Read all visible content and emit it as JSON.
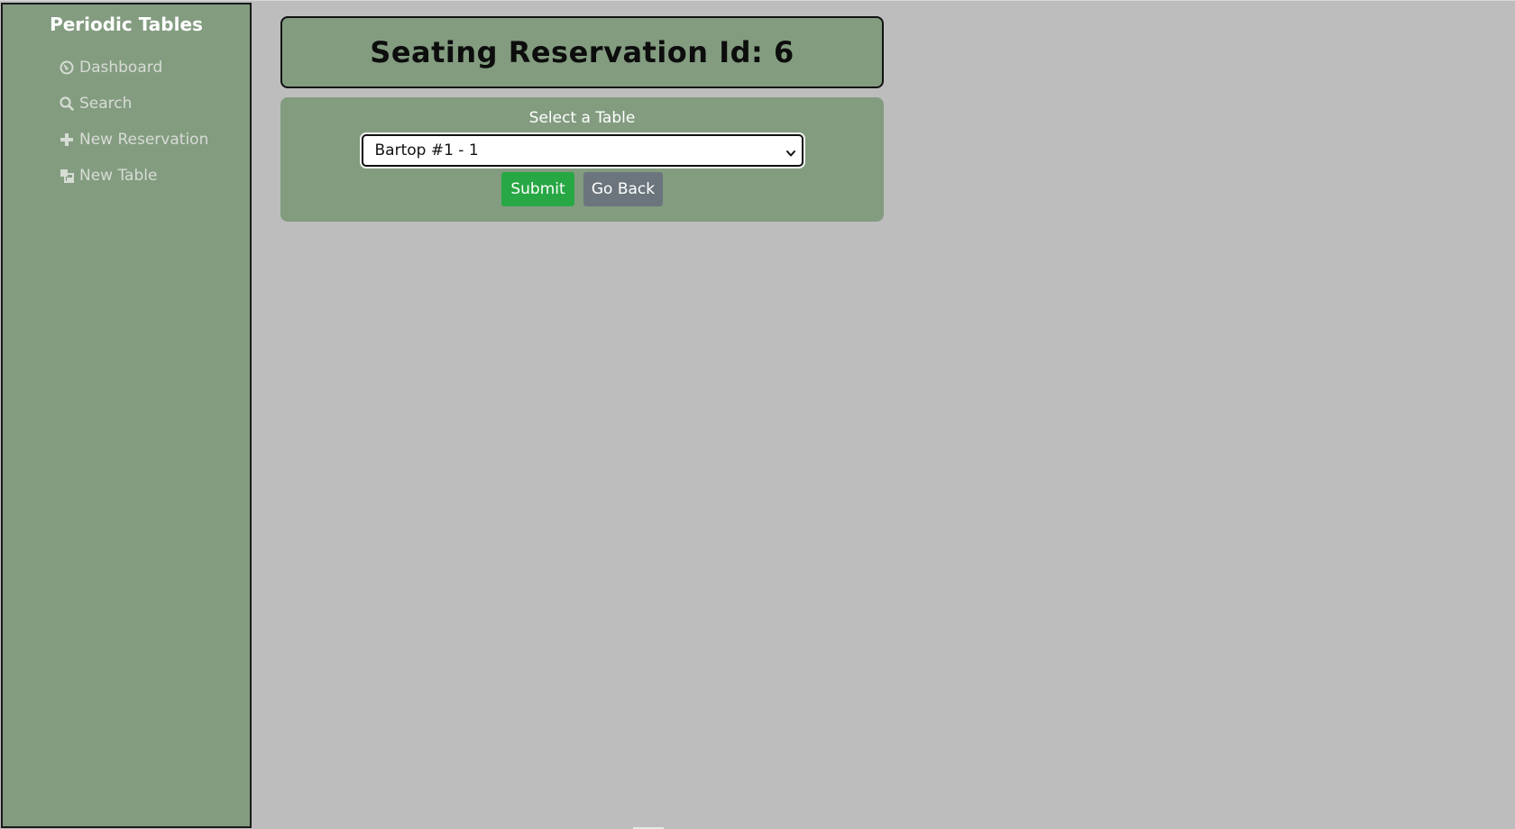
{
  "sidebar": {
    "brand": "Periodic Tables",
    "items": [
      {
        "label": "Dashboard",
        "icon": "dashboard-icon"
      },
      {
        "label": "Search",
        "icon": "search-icon"
      },
      {
        "label": "New Reservation",
        "icon": "plus-icon"
      },
      {
        "label": "New Table",
        "icon": "table-icon"
      }
    ]
  },
  "main": {
    "title": "Seating Reservation Id: 6",
    "form": {
      "label": "Select a Table",
      "selected_table": "Bartop #1 - 1",
      "submit_label": "Submit",
      "back_label": "Go Back"
    }
  },
  "colors": {
    "panel": "#839c80",
    "background": "#bdbdbd",
    "submit": "#28a745",
    "back": "#6c757d"
  }
}
